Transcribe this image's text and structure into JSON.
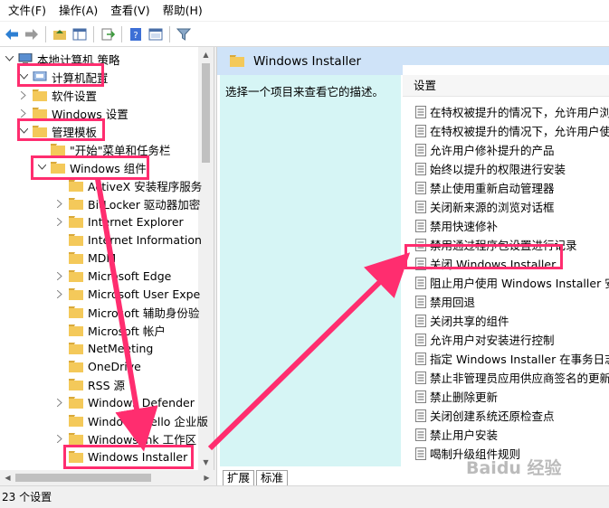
{
  "menubar": [
    "文件(F)",
    "操作(A)",
    "查看(V)",
    "帮助(H)"
  ],
  "toolbar": [
    "back-icon",
    "forward-icon",
    "up-folder-icon",
    "show-tree-icon",
    "export-list-icon",
    "help-icon",
    "properties-icon",
    "filter-icon"
  ],
  "tree": [
    {
      "label": "本地计算机 策略",
      "icon": "computer-icon"
    },
    {
      "label": "计算机配置",
      "icon": "computer-config-icon",
      "highlight": true
    },
    {
      "label": "软件设置",
      "icon": "folder-icon"
    },
    {
      "label": "Windows 设置",
      "icon": "folder-icon"
    },
    {
      "label": "管理模板",
      "icon": "folder-icon",
      "highlight": true
    },
    {
      "label": "\"开始\"菜单和任务栏",
      "icon": "folder-icon"
    },
    {
      "label": "Windows 组件",
      "icon": "folder-icon",
      "highlight": true
    },
    {
      "label": "ActiveX 安装程序服务",
      "icon": "folder-icon"
    },
    {
      "label": "BitLocker 驱动器加密",
      "icon": "folder-icon"
    },
    {
      "label": "Internet Explorer",
      "icon": "folder-icon"
    },
    {
      "label": "Internet Information",
      "icon": "folder-icon"
    },
    {
      "label": "MDM",
      "icon": "folder-icon"
    },
    {
      "label": "Microsoft Edge",
      "icon": "folder-icon"
    },
    {
      "label": "Microsoft User Expe",
      "icon": "folder-icon"
    },
    {
      "label": "Microsoft 辅助身份验",
      "icon": "folder-icon"
    },
    {
      "label": "Microsoft 帐户",
      "icon": "folder-icon"
    },
    {
      "label": "NetMeeting",
      "icon": "folder-icon"
    },
    {
      "label": "OneDrive",
      "icon": "folder-icon"
    },
    {
      "label": "RSS 源",
      "icon": "folder-icon"
    },
    {
      "label": "Windows Defender",
      "icon": "folder-icon"
    },
    {
      "label": "Windows Hello 企业版",
      "icon": "folder-icon"
    },
    {
      "label": "Windows Ink 工作区",
      "icon": "folder-icon"
    },
    {
      "label": "Windows Installer",
      "icon": "folder-icon",
      "highlight": true,
      "selected": true
    }
  ],
  "right": {
    "header": "Windows Installer",
    "description": "选择一个项目来查看它的描述。",
    "column": "设置",
    "items": [
      "在特权被提升的情况下，允许用户浏览",
      "在特权被提升的情况下，允许用户使用",
      "允许用户修补提升的产品",
      "始终以提升的权限进行安装",
      "禁止使用重新启动管理器",
      "关闭新来源的浏览对话框",
      "禁用快速修补",
      "禁用通过程序包设置进行记录",
      "关闭 Windows Installer",
      "阻止用户使用 Windows Installer 安",
      "禁用回退",
      "关闭共享的组件",
      "允许用户对安装进行控制",
      "指定 Windows Installer 在事务日志",
      "禁止非管理员应用供应商签名的更新",
      "禁止删除更新",
      "关闭创建系统还原检查点",
      "禁止用户安装",
      "喝制升级组件规则"
    ],
    "tabs": [
      "扩展",
      "标准"
    ]
  },
  "status": "23 个设置",
  "watermark": "Baidu 经验",
  "colors": {
    "highlight": "#ff2d6f",
    "header": "#cfe3f8",
    "description_bg": "#d6f5f5"
  }
}
